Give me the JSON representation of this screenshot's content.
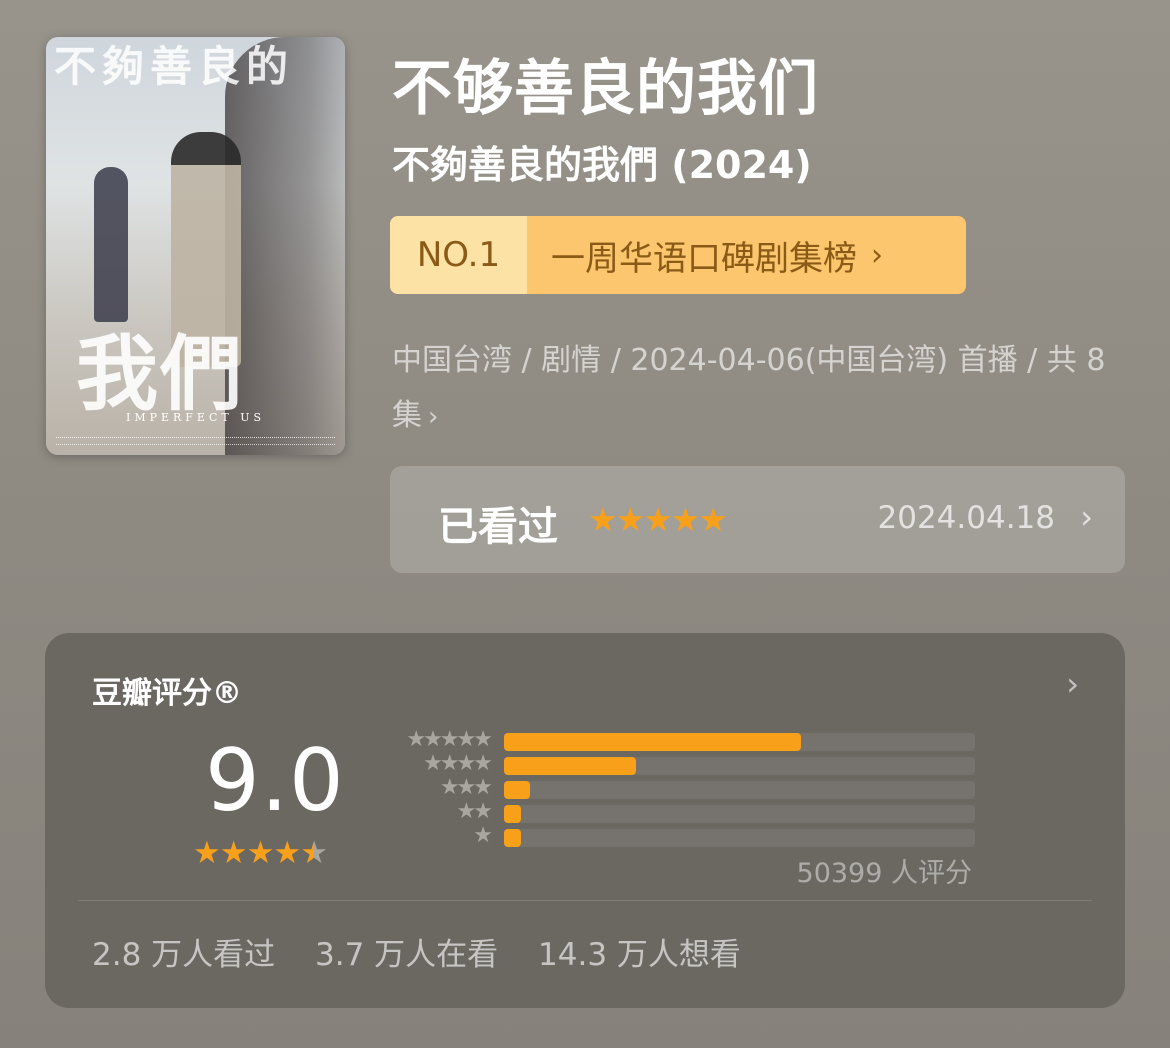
{
  "poster": {
    "calligraphy_top": "不夠善良的",
    "calligraphy_bottom": "我們",
    "english_title": "IMPERFECT US"
  },
  "title": "不够善良的我们",
  "original_title": "不夠善良的我們 (2024)",
  "rank": {
    "number": "NO.1",
    "label": "一周华语口碑剧集榜"
  },
  "meta": {
    "line": "中国台湾 / 剧情 / 2024-04-06(中国台湾) 首播 / 共 8 集"
  },
  "user_rating": {
    "status": "已看过",
    "stars": 5,
    "date": "2024.04.18"
  },
  "rating_panel": {
    "title": "豆瓣评分®",
    "score": "9.0",
    "avg_stars": 4.5,
    "distribution": [
      {
        "stars": 5,
        "fraction": 0.63
      },
      {
        "stars": 4,
        "fraction": 0.28
      },
      {
        "stars": 3,
        "fraction": 0.055
      },
      {
        "stars": 2,
        "fraction": 0.036
      },
      {
        "stars": 1,
        "fraction": 0.036
      }
    ],
    "rater_count": "50399 人评分",
    "stats": {
      "watched": "2.8 万人看过",
      "watching": "3.7 万人在看",
      "want": "14.3 万人想看"
    }
  },
  "colors": {
    "accent": "#f9a01b",
    "rank_bg": "#fbc66d",
    "rank_text": "#8a5a16"
  }
}
